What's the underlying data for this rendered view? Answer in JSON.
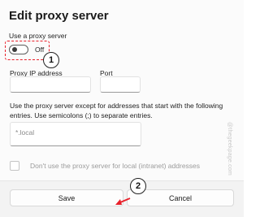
{
  "dialog": {
    "title": "Edit proxy server",
    "use_proxy_label": "Use a proxy server",
    "toggle": {
      "state": "Off",
      "on": false
    },
    "ip_label": "Proxy IP address",
    "ip_value": "",
    "port_label": "Port",
    "port_value": "",
    "exceptions_description": "Use the proxy server except for addresses that start with the following entries. Use semicolons (;) to separate entries.",
    "exceptions_placeholder": "*.local",
    "local_checkbox_label": "Don't use the proxy server for local (intranet) addresses",
    "local_checkbox_checked": false
  },
  "footer": {
    "save_label": "Save",
    "cancel_label": "Cancel"
  },
  "annotations": {
    "step1": "1",
    "step2": "2",
    "accent_color": "#e8202a"
  },
  "watermark": "@thegeekpage.com"
}
